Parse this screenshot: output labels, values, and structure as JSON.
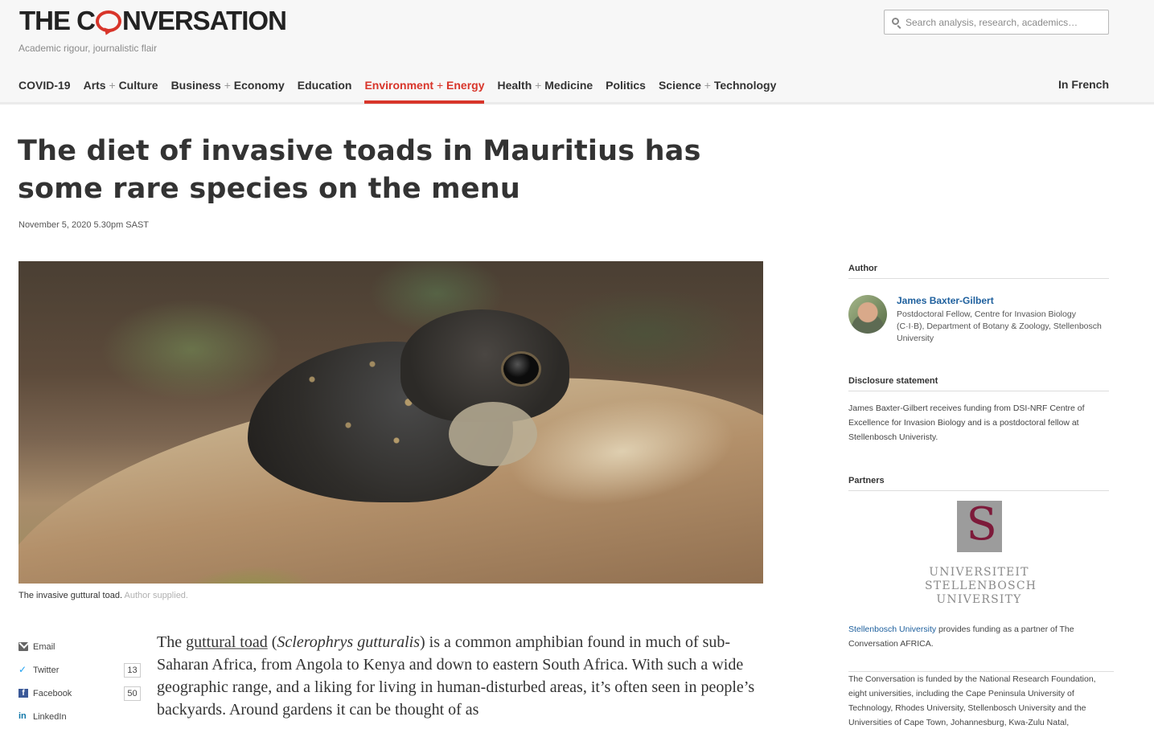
{
  "header": {
    "logo_text_before": "THE C",
    "logo_text_after": "NVERSATION",
    "tagline": "Academic rigour, journalistic flair",
    "search_placeholder": "Search analysis, research, academics…",
    "in_french": "In French"
  },
  "nav": [
    {
      "a": "COVID-19",
      "b": ""
    },
    {
      "a": "Arts",
      "b": "Culture"
    },
    {
      "a": "Business",
      "b": "Economy"
    },
    {
      "a": "Education",
      "b": ""
    },
    {
      "a": "Environment",
      "b": "Energy"
    },
    {
      "a": "Health",
      "b": "Medicine"
    },
    {
      "a": "Politics",
      "b": ""
    },
    {
      "a": "Science",
      "b": "Technology"
    }
  ],
  "article": {
    "headline": "The diet of invasive toads in Mauritius has some rare species on the menu",
    "date": "November 5, 2020 5.30pm SAST",
    "caption": "The invasive guttural toad.",
    "caption_credit": "Author supplied.",
    "body_before_link": "The ",
    "body_link": "guttural toad",
    "body_open": " (",
    "body_italic": "Sclerophrys gutturalis",
    "body_after": ") is a common amphibian found in much of sub-Saharan Africa, from Angola to Kenya and down to eastern South Africa. With such a wide geographic range, and a liking for living in human-disturbed areas, it’s often seen in people’s backyards. Around gardens it can be thought of as"
  },
  "share": {
    "email": "Email",
    "twitter": "Twitter",
    "twitter_count": "13",
    "facebook": "Facebook",
    "facebook_count": "50",
    "linkedin": "LinkedIn"
  },
  "sidebar": {
    "author_heading": "Author",
    "author_name": "James Baxter-Gilbert",
    "author_role": "Postdoctoral Fellow, Centre for Invasion Biology (C·I·B), Department of Botany & Zoology, Stellenbosch University",
    "disclosure_heading": "Disclosure statement",
    "disclosure_text": "James Baxter-Gilbert receives funding from DSI-NRF Centre of Excellence for Invasion Biology and is a postdoctoral fellow at Stellenbosch Univeristy.",
    "partners_heading": "Partners",
    "uni_line1": "UNIVERSITEIT",
    "uni_line2": "STELLENBOSCH",
    "uni_line3": "UNIVERSITY",
    "partner_link": "Stellenbosch University",
    "partner_text": " provides funding as a partner of The Conversation AFRICA.",
    "funding_text": "The Conversation is funded by the National Research Foundation, eight universities, including the Cape Peninsula University of Technology, Rhodes University, Stellenbosch University and the Universities of Cape Town, Johannesburg, Kwa-Zulu Natal,"
  },
  "colors": {
    "brand_red": "#d8352a",
    "link_blue": "#1d5f9d"
  }
}
